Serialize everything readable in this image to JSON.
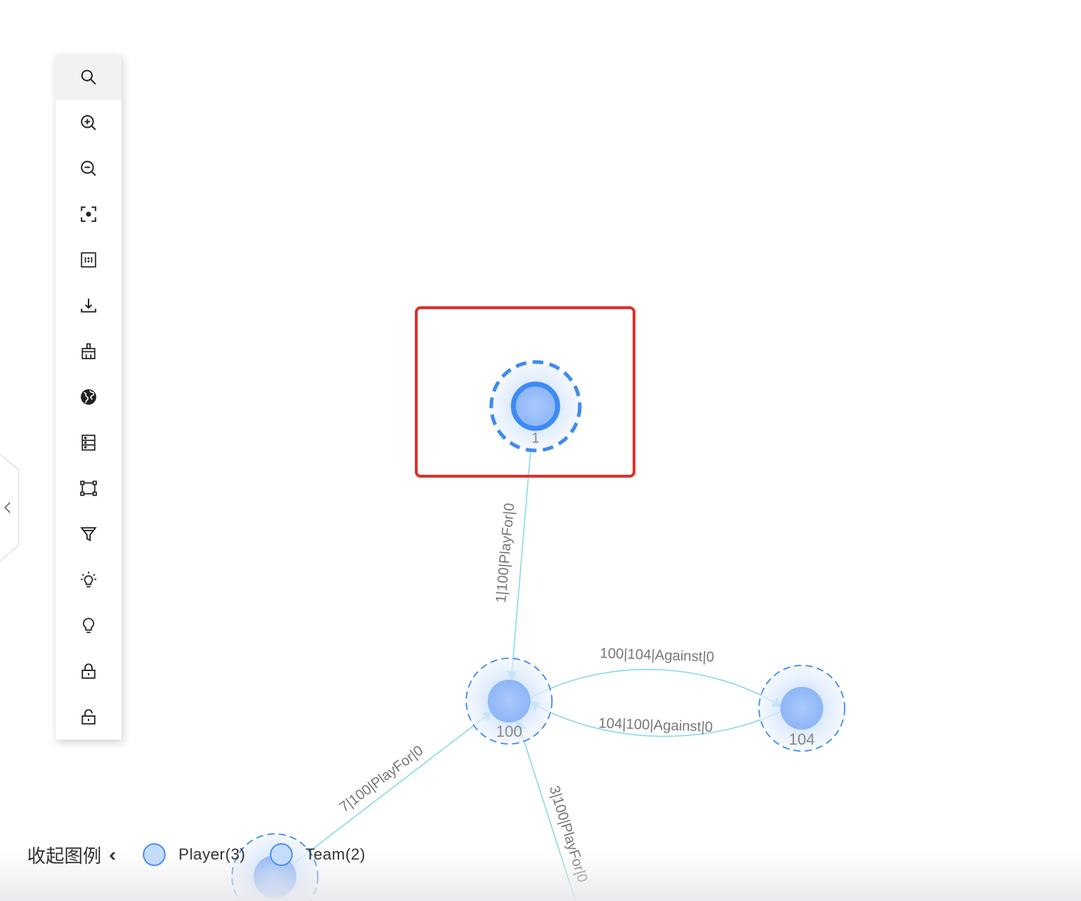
{
  "toolbar": {
    "items": [
      {
        "name": "search",
        "icon": "search-icon"
      },
      {
        "name": "zoom-in",
        "icon": "zoom-in-icon"
      },
      {
        "name": "zoom-out",
        "icon": "zoom-out-icon"
      },
      {
        "name": "fit-view",
        "icon": "focus-icon"
      },
      {
        "name": "actual-size",
        "icon": "one-to-one-icon"
      },
      {
        "name": "download",
        "icon": "download-icon"
      },
      {
        "name": "clear",
        "icon": "broom-icon"
      },
      {
        "name": "globe",
        "icon": "globe-icon"
      },
      {
        "name": "data-list",
        "icon": "list-icon"
      },
      {
        "name": "box-select",
        "icon": "box-select-icon"
      },
      {
        "name": "filter",
        "icon": "filter-icon"
      },
      {
        "name": "highlight-on",
        "icon": "lightbulb-on-icon"
      },
      {
        "name": "highlight-off",
        "icon": "lightbulb-icon"
      },
      {
        "name": "lock",
        "icon": "lock-icon"
      },
      {
        "name": "unlock",
        "icon": "unlock-icon"
      }
    ]
  },
  "side_toggle": {
    "icon": "chevron-left-icon"
  },
  "graph": {
    "nodes": [
      {
        "id": "1",
        "label": "1",
        "type": "Team",
        "selected": true
      },
      {
        "id": "100",
        "label": "100",
        "type": "Team"
      },
      {
        "id": "104",
        "label": "104",
        "type": "Team"
      },
      {
        "id": "7",
        "label": "",
        "type": "Player"
      }
    ],
    "edges": [
      {
        "id": "e1",
        "label": "1|100|PlayFor|0",
        "source": "1",
        "target": "100"
      },
      {
        "id": "e2",
        "label": "100|104|Against|0",
        "source": "100",
        "target": "104"
      },
      {
        "id": "e3",
        "label": "104|100|Against|0",
        "source": "104",
        "target": "100"
      },
      {
        "id": "e4",
        "label": "7|100|PlayFor|0",
        "source": "7",
        "target": "100"
      },
      {
        "id": "e5",
        "label": "3|100|PlayFor|0",
        "source": "3",
        "target": "100"
      }
    ]
  },
  "colors": {
    "node_fill": "#94bcf9",
    "node_border": "#3d8bf2",
    "edge": "#88dbe0",
    "selection_box": "#e0302a",
    "label": "#777777"
  },
  "legend": {
    "toggle_label": "收起图例",
    "toggle_icon": "double-chevron-left-icon",
    "items": [
      {
        "label": "Player(3)"
      },
      {
        "label": "Team(2)"
      }
    ]
  }
}
